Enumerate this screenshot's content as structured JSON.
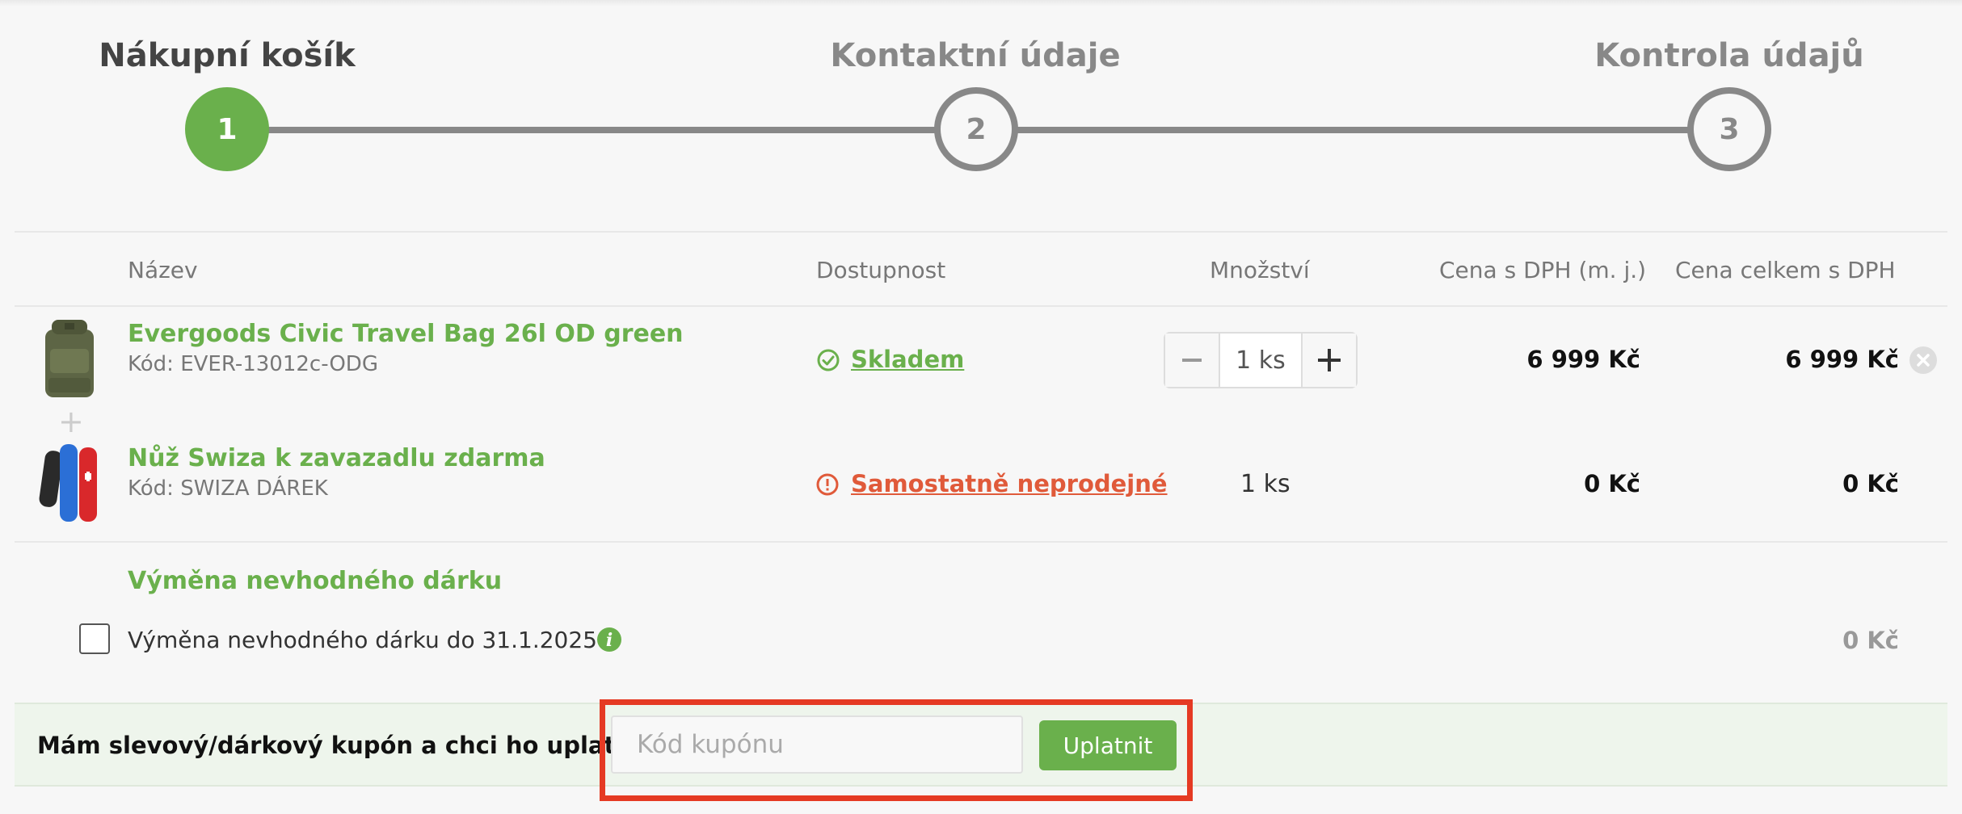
{
  "stepper": {
    "steps": [
      {
        "title": "Nákupní košík",
        "number": "1"
      },
      {
        "title": "Kontaktní údaje",
        "number": "2"
      },
      {
        "title": "Kontrola údajů",
        "number": "3"
      }
    ]
  },
  "table": {
    "headers": {
      "name": "Název",
      "availability": "Dostupnost",
      "quantity": "Množství",
      "unit_price": "Cena s DPH (m. j.)",
      "total_price": "Cena celkem s DPH"
    },
    "items": [
      {
        "name": "Evergoods Civic Travel Bag 26l OD green",
        "code": "Kód: EVER-13012c-ODG",
        "availability": "Skladem",
        "quantity": "1 ks",
        "unit_price": "6 999 Kč",
        "total_price": "6 999 Kč"
      },
      {
        "name": "Nůž Swiza k zavazadlu zdarma",
        "code": "Kód: SWIZA DÁREK",
        "availability": "Samostatně neprodejné",
        "quantity": "1 ks",
        "unit_price": "0 Kč",
        "total_price": "0 Kč"
      }
    ],
    "plus_sign": "+"
  },
  "exchange": {
    "title": "Výměna nevhodného dárku",
    "option_label": "Výměna nevhodného dárku do 31.1.2025",
    "price": "0 Kč"
  },
  "coupon": {
    "label": "Mám slevový/dárkový kupón a chci ho uplatnit:",
    "placeholder": "Kód kupónu",
    "button": "Uplatnit"
  },
  "colors": {
    "accent": "#6ab04c",
    "warning": "#e05a3a",
    "highlight": "#e53a23"
  },
  "icons": {
    "available": "check-circle-icon",
    "warning": "exclamation-circle-icon",
    "info": "info-icon",
    "remove": "close-circle-icon",
    "minus": "minus-icon",
    "plus": "plus-icon"
  }
}
